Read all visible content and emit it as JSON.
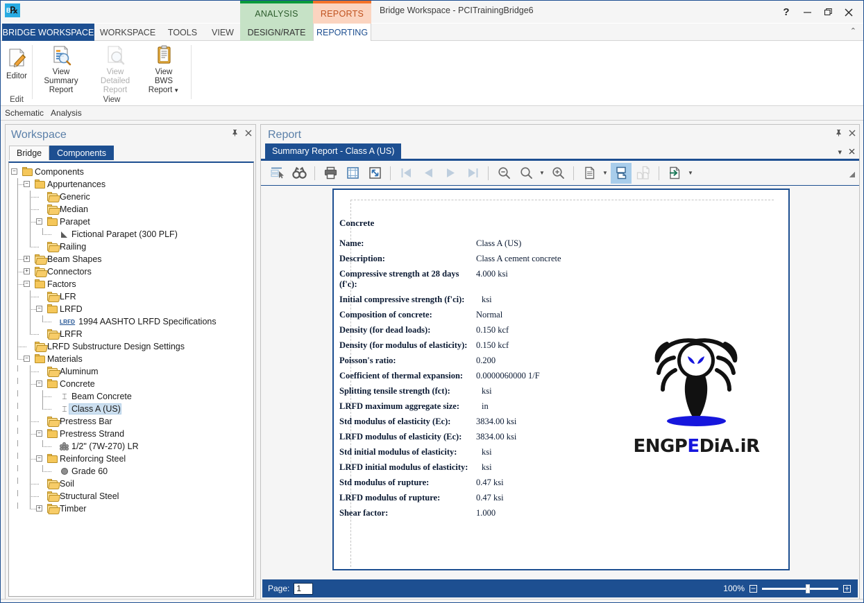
{
  "window": {
    "title": "Bridge Workspace - PCITrainingBridge6",
    "logo_text": "Br",
    "help_label": "?",
    "minimize_label": "─",
    "restore_label": "❐",
    "close_label": "✕",
    "collapse_ribbon_label": "⌃"
  },
  "context_tabs": [
    {
      "label": "ANALYSIS",
      "accent": "#0a9a3c",
      "bg": "#c6e2c6"
    },
    {
      "label": "REPORTS",
      "accent": "#f4732a",
      "bg": "#fbd4c0"
    }
  ],
  "ribbon_tabs": [
    {
      "label": "BRIDGE WORKSPACE",
      "active": true
    },
    {
      "label": "WORKSPACE",
      "active": false
    },
    {
      "label": "TOOLS",
      "active": false
    },
    {
      "label": "VIEW",
      "active": false
    },
    {
      "label": "DESIGN/RATE",
      "active": false
    },
    {
      "label": "REPORTING",
      "active": true
    }
  ],
  "ribbon": {
    "groups": [
      {
        "title": "Edit",
        "buttons": [
          {
            "label": "Editor",
            "icon": "edit-document-icon",
            "disabled": false
          }
        ]
      },
      {
        "title": "View",
        "buttons": [
          {
            "label": "View Summary Report",
            "icon": "summary-report-icon",
            "disabled": false
          },
          {
            "label": "View Detailed Report",
            "icon": "detailed-report-icon",
            "disabled": true
          },
          {
            "label": "View BWS Report",
            "icon": "clipboard-icon",
            "disabled": false,
            "has_dropdown": true
          }
        ]
      }
    ]
  },
  "quick_strip": [
    {
      "label": "Schematic"
    },
    {
      "label": "Analysis"
    }
  ],
  "workspace_panel": {
    "title": "Workspace",
    "pin_label": "⍠",
    "close_label": "✕",
    "tabs": [
      {
        "label": "Bridge",
        "active": false
      },
      {
        "label": "Components",
        "active": true
      }
    ],
    "tree": [
      {
        "label": "Components",
        "depth": 0,
        "icon": "folder-open-icon",
        "expander": "minus",
        "selected": false
      },
      {
        "label": "Appurtenances",
        "depth": 1,
        "icon": "folder-open-icon",
        "expander": "minus",
        "selected": false
      },
      {
        "label": "Generic",
        "depth": 2,
        "icon": "folder-closed-icon",
        "expander": "none",
        "selected": false
      },
      {
        "label": "Median",
        "depth": 2,
        "icon": "folder-closed-icon",
        "expander": "none",
        "selected": false
      },
      {
        "label": "Parapet",
        "depth": 2,
        "icon": "folder-open-icon",
        "expander": "minus",
        "selected": false
      },
      {
        "label": "Fictional Parapet (300 PLF)",
        "depth": 3,
        "icon": "parapet-icon",
        "expander": "none",
        "selected": false
      },
      {
        "label": "Railing",
        "depth": 2,
        "icon": "folder-closed-icon",
        "expander": "none",
        "selected": false
      },
      {
        "label": "Beam Shapes",
        "depth": 1,
        "icon": "folder-closed-icon",
        "expander": "plus",
        "selected": false
      },
      {
        "label": "Connectors",
        "depth": 1,
        "icon": "folder-closed-icon",
        "expander": "plus",
        "selected": false
      },
      {
        "label": "Factors",
        "depth": 1,
        "icon": "folder-open-icon",
        "expander": "minus",
        "selected": false
      },
      {
        "label": "LFR",
        "depth": 2,
        "icon": "folder-closed-icon",
        "expander": "none",
        "selected": false
      },
      {
        "label": "LRFD",
        "depth": 2,
        "icon": "folder-open-icon",
        "expander": "minus",
        "selected": false
      },
      {
        "label": "1994 AASHTO LRFD Specifications",
        "depth": 3,
        "icon": "lrfd-spec-icon",
        "expander": "none",
        "selected": false
      },
      {
        "label": "LRFR",
        "depth": 2,
        "icon": "folder-closed-icon",
        "expander": "none",
        "selected": false
      },
      {
        "label": "LRFD Substructure Design Settings",
        "depth": 1,
        "icon": "folder-closed-icon",
        "expander": "none",
        "selected": false
      },
      {
        "label": "Materials",
        "depth": 1,
        "icon": "folder-open-icon",
        "expander": "minus",
        "selected": false
      },
      {
        "label": "Aluminum",
        "depth": 2,
        "icon": "folder-closed-icon",
        "expander": "none",
        "selected": false
      },
      {
        "label": "Concrete",
        "depth": 2,
        "icon": "folder-open-icon",
        "expander": "minus",
        "selected": false
      },
      {
        "label": "Beam Concrete",
        "depth": 3,
        "icon": "ibeam-icon",
        "expander": "none",
        "selected": false
      },
      {
        "label": "Class A (US)",
        "depth": 3,
        "icon": "ibeam-icon",
        "expander": "none",
        "selected": true
      },
      {
        "label": "Prestress Bar",
        "depth": 2,
        "icon": "folder-closed-icon",
        "expander": "none",
        "selected": false
      },
      {
        "label": "Prestress Strand",
        "depth": 2,
        "icon": "folder-open-icon",
        "expander": "minus",
        "selected": false
      },
      {
        "label": "1/2\" (7W-270) LR",
        "depth": 3,
        "icon": "strand-icon",
        "expander": "none",
        "selected": false
      },
      {
        "label": "Reinforcing Steel",
        "depth": 2,
        "icon": "folder-open-icon",
        "expander": "minus",
        "selected": false
      },
      {
        "label": "Grade 60",
        "depth": 3,
        "icon": "rebar-icon",
        "expander": "none",
        "selected": false
      },
      {
        "label": "Soil",
        "depth": 2,
        "icon": "folder-closed-icon",
        "expander": "none",
        "selected": false
      },
      {
        "label": "Structural Steel",
        "depth": 2,
        "icon": "folder-closed-icon",
        "expander": "none",
        "selected": false
      },
      {
        "label": "Timber",
        "depth": 2,
        "icon": "folder-closed-icon",
        "expander": "plus",
        "selected": false
      }
    ]
  },
  "report_panel": {
    "title": "Report",
    "pin_label": "⍠",
    "close_label": "✕",
    "dropdown_label": "▾",
    "tab_label": "Summary Report - Class A (US)",
    "toolbar": [
      {
        "icon": "document-map-icon",
        "name": "document-map-button",
        "disabled": false,
        "active": false
      },
      {
        "icon": "find-binoculars-icon",
        "name": "find-button",
        "disabled": false,
        "active": false
      },
      {
        "icon": "print-icon",
        "name": "print-button",
        "disabled": false,
        "active": false
      },
      {
        "icon": "page-setup-icon",
        "name": "page-setup-button",
        "disabled": false,
        "active": false
      },
      {
        "icon": "print-layout-icon",
        "name": "print-layout-button",
        "disabled": false,
        "active": false
      },
      {
        "icon": "first-page-icon",
        "name": "first-page-button",
        "disabled": true,
        "active": false
      },
      {
        "icon": "previous-page-icon",
        "name": "previous-page-button",
        "disabled": true,
        "active": false
      },
      {
        "icon": "next-page-icon",
        "name": "next-page-button",
        "disabled": true,
        "active": false
      },
      {
        "icon": "last-page-icon",
        "name": "last-page-button",
        "disabled": true,
        "active": false
      },
      {
        "icon": "zoom-out-icon",
        "name": "zoom-out-button",
        "disabled": false,
        "active": false
      },
      {
        "icon": "zoom-icon",
        "name": "zoom-button",
        "disabled": false,
        "active": false
      },
      {
        "icon": "zoom-in-icon",
        "name": "zoom-in-button",
        "disabled": false,
        "active": false
      },
      {
        "icon": "single-page-icon",
        "name": "single-page-button",
        "disabled": false,
        "active": false
      },
      {
        "icon": "continuous-page-icon",
        "name": "continuous-page-button",
        "disabled": false,
        "active": true
      },
      {
        "icon": "two-page-icon",
        "name": "two-page-button",
        "disabled": true,
        "active": false
      },
      {
        "icon": "export-icon",
        "name": "export-button",
        "disabled": false,
        "active": false
      }
    ],
    "status": {
      "page_label": "Page:",
      "page_value": "1",
      "zoom_pct": "100%",
      "zoom_minus": "−",
      "zoom_plus": "+"
    }
  },
  "report": {
    "heading": "Concrete",
    "rows": [
      {
        "label": "Name:",
        "value": "Class A (US)",
        "indent": false
      },
      {
        "label": "Description:",
        "value": "Class A cement concrete",
        "indent": false
      },
      {
        "label": "Compressive strength at 28 days (f'c):",
        "value": "4.000 ksi",
        "indent": false
      },
      {
        "label": "Initial compressive strength (f'ci):",
        "value": "ksi",
        "indent": true
      },
      {
        "label": "Composition of concrete:",
        "value": "Normal",
        "indent": false
      },
      {
        "label": "Density (for dead loads):",
        "value": "0.150 kcf",
        "indent": false
      },
      {
        "label": "Density (for modulus of elasticity):",
        "value": "0.150 kcf",
        "indent": false
      },
      {
        "label": "Poisson's ratio:",
        "value": "0.200",
        "indent": false
      },
      {
        "label": "Coefficient of thermal expansion:",
        "value": "0.0000060000 1/F",
        "indent": false
      },
      {
        "label": "Splitting tensile strength (fct):",
        "value": "ksi",
        "indent": true
      },
      {
        "label": "LRFD maximum aggregate size:",
        "value": "in",
        "indent": true
      },
      {
        "label": "Std modulus of elasticity (Ec):",
        "value": "3834.00 ksi",
        "indent": false
      },
      {
        "label": "LRFD modulus of elasticity (Ec):",
        "value": "3834.00 ksi",
        "indent": false
      },
      {
        "label": "Std initial modulus of elasticity:",
        "value": "ksi",
        "indent": true
      },
      {
        "label": "LRFD initial modulus of elasticity:",
        "value": "ksi",
        "indent": true
      },
      {
        "label": "Std modulus of rupture:",
        "value": "0.47 ksi",
        "indent": false
      },
      {
        "label": "LRFD modulus of rupture:",
        "value": "0.47 ksi",
        "indent": false
      },
      {
        "label": "Shear factor:",
        "value": "1.000",
        "indent": false
      }
    ],
    "watermark": {
      "icon": "spider-logo-icon",
      "text_part1": "ENGP",
      "text_part2": "E",
      "text_part3": "DiA.iR",
      "color_dark": "#1a1a1a",
      "color_blue": "#1616dd"
    }
  }
}
